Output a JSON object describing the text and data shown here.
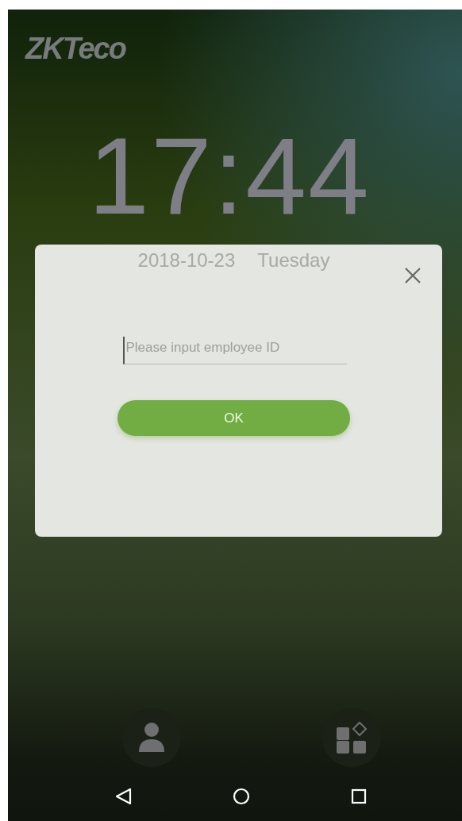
{
  "logo": "ZKTeco",
  "clock": {
    "time": "17:44",
    "date": "2018-10-23",
    "weekday": "Tuesday"
  },
  "dialog": {
    "input": {
      "placeholder": "Please input employee ID"
    },
    "ok_button": "OK"
  },
  "nav_bar": {
    "buttons": [
      {
        "kind": "back"
      },
      {
        "kind": "home"
      },
      {
        "kind": "recents"
      }
    ]
  }
}
